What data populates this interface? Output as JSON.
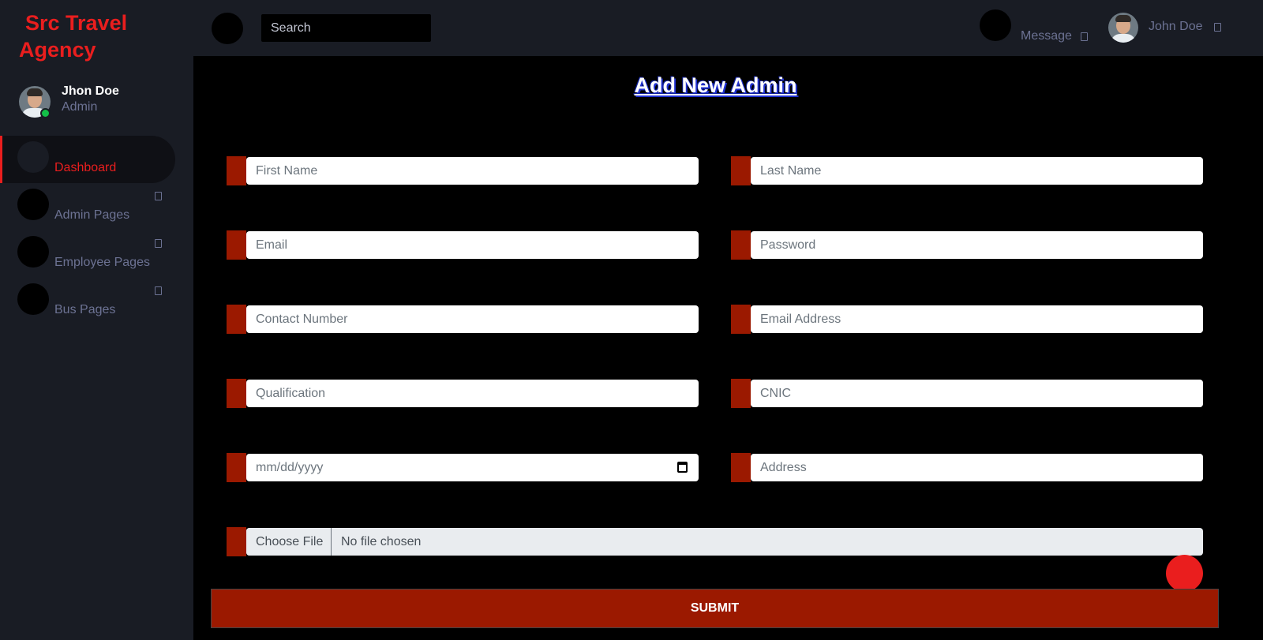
{
  "brand": {
    "line1": "Src Travel",
    "line2": "Agency"
  },
  "sidebar": {
    "profile": {
      "name": "Jhon Doe",
      "role": "Admin",
      "status_color": "#12c048"
    },
    "items": [
      {
        "label": "Dashboard",
        "active": true
      },
      {
        "label": "Admin Pages"
      },
      {
        "label": "Employee Pages"
      },
      {
        "label": "Bus Pages"
      }
    ]
  },
  "topbar": {
    "search_placeholder": "Search",
    "message_label": "Message",
    "user_name": "John Doe"
  },
  "form": {
    "title": "Add New Admin",
    "fields": {
      "first_name": "First Name",
      "last_name": "Last Name",
      "email": "Email",
      "password": "Password",
      "contact_number": "Contact Number",
      "email_address": "Email Address",
      "qualification": "Qualification",
      "cnic": "CNIC",
      "date": "mm/dd/yyyy",
      "address": "Address"
    },
    "file": {
      "button_label": "Choose File",
      "status": "No file chosen"
    },
    "submit_label": "SUBMIT"
  },
  "colors": {
    "accent_red": "#ea1e1e",
    "field_bar": "#9b1900",
    "sidebar_bg": "#191c24",
    "content_bg": "#000000",
    "muted_text": "#6c7293"
  },
  "icons": {
    "caret": "chevron-down-icon",
    "calendar": "calendar-icon"
  }
}
